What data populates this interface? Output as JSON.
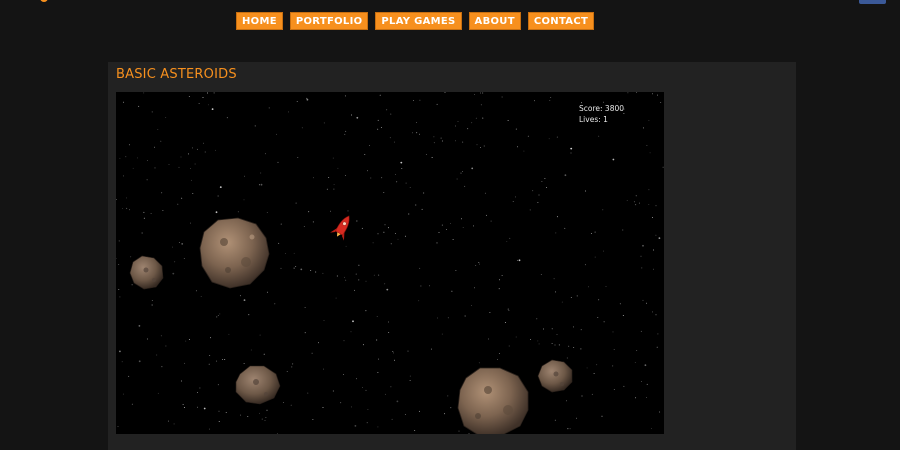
{
  "nav": {
    "items": [
      {
        "label": "HOME"
      },
      {
        "label": "PORTFOLIO"
      },
      {
        "label": "PLAY GAMES"
      },
      {
        "label": "ABOUT"
      },
      {
        "label": "CONTACT"
      }
    ]
  },
  "game": {
    "title": "BASIC ASTEROIDS",
    "score_text": "Score: 3800",
    "lives_text": "Lives: 1",
    "score": 3800,
    "lives": 1
  },
  "colors": {
    "accent": "#f7901e",
    "page_bg": "#141414",
    "panel_bg": "#222222",
    "canvas_bg": "#000000"
  },
  "icons": {
    "ship": "rocket-ship-icon",
    "asteroid": "asteroid-icon"
  }
}
